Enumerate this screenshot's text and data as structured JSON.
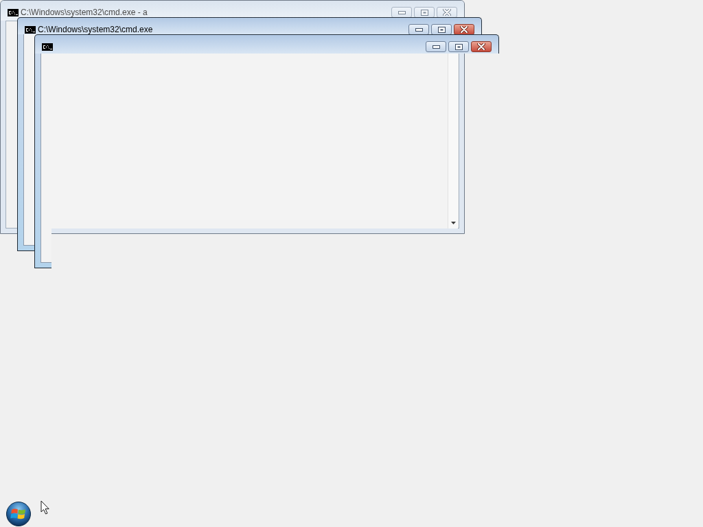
{
  "windows": [
    {
      "title": "C:\\Windows\\system32\\cmd.exe - a",
      "active": false
    },
    {
      "title": "C:\\Windows\\system32\\cmd.exe",
      "active": true
    },
    {
      "active": true
    }
  ]
}
